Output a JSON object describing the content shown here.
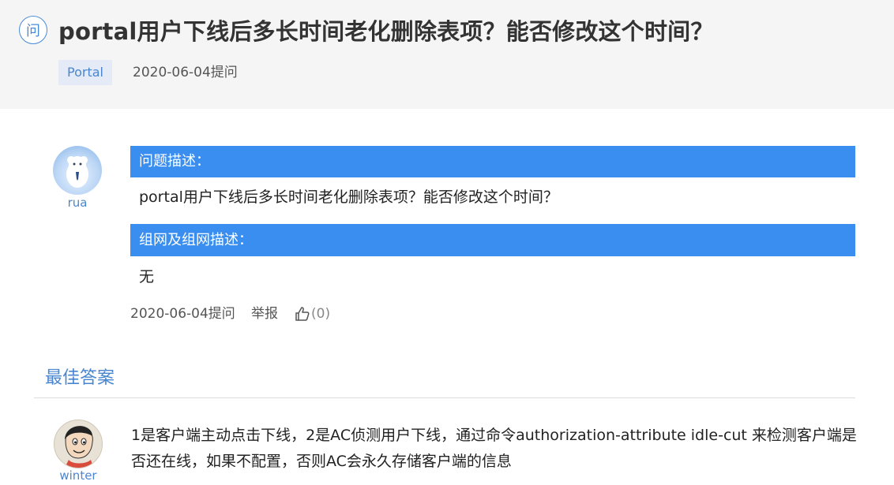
{
  "question": {
    "badge": "问",
    "title": "portal用户下线后多长时间老化删除表项？能否修改这个时间？",
    "tag": "Portal",
    "asked": "2020-06-04提问"
  },
  "post": {
    "author": "rua",
    "section1_label": "问题描述：",
    "section1_text": "portal用户下线后多长时间老化删除表项？能否修改这个时间？",
    "section2_label": "组网及组网描述：",
    "section2_text": "无",
    "asked": "2020-06-04提问",
    "report_label": "举报",
    "like_count": "(0)"
  },
  "best_answer": {
    "heading": "最佳答案",
    "author": "winter",
    "text": "1是客户端主动点击下线，2是AC侦测用户下线，通过命令authorization-attribute idle-cut 来检测客户端是否还在线，如果不配置，否则AC会永久存储客户端的信息"
  },
  "colors": {
    "accent": "#3a8ef0",
    "link": "#4a86cf",
    "header_bg": "#f5f5f5",
    "tag_bg": "#e4ebf7"
  },
  "icons": {
    "question_badge": "question-badge-icon",
    "like": "thumbs-up-icon"
  }
}
